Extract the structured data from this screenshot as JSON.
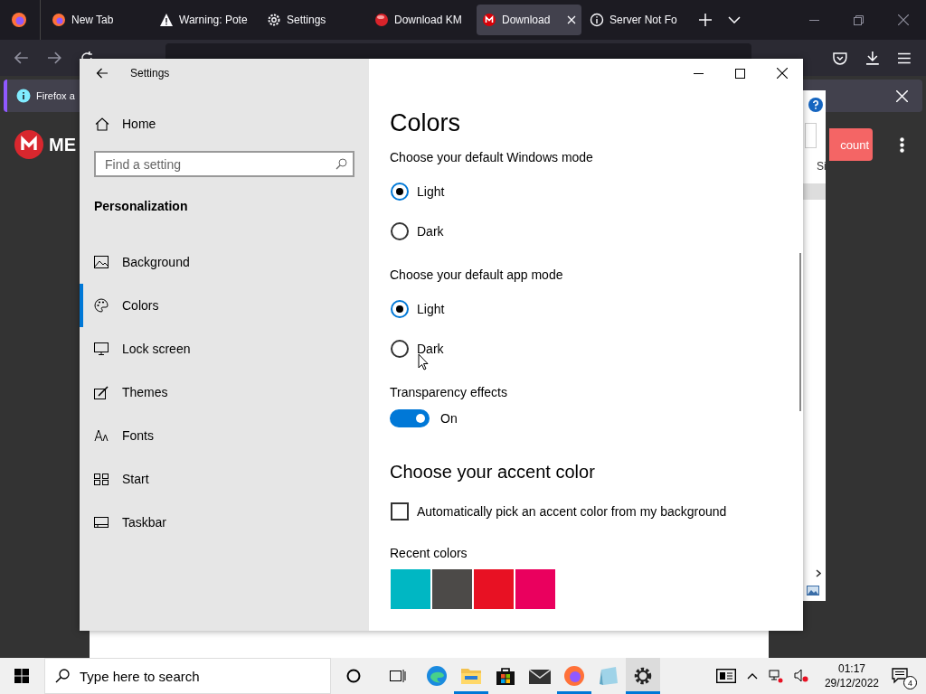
{
  "browser": {
    "tabs": [
      {
        "label": "New Tab",
        "kind": "firefox",
        "selected": false
      },
      {
        "label": "Warning: Pote",
        "kind": "warning",
        "selected": false
      },
      {
        "label": "Settings",
        "kind": "gear",
        "selected": false
      },
      {
        "label": "Download KM",
        "kind": "ball",
        "selected": false
      },
      {
        "label": "Download",
        "kind": "mega",
        "selected": true
      },
      {
        "label": "Server Not Fo",
        "kind": "info",
        "selected": false
      }
    ],
    "notification": {
      "text": "Firefox a"
    },
    "page": {
      "logo_text": "ME",
      "button": "count",
      "column_1": "Si"
    }
  },
  "settings": {
    "title": "Settings",
    "home": "Home",
    "search": {
      "placeholder": "Find a setting"
    },
    "section": "Personalization",
    "nav": [
      {
        "label": "Background",
        "kind": "background",
        "selected": false
      },
      {
        "label": "Colors",
        "kind": "colors",
        "selected": true
      },
      {
        "label": "Lock screen",
        "kind": "lock",
        "selected": false
      },
      {
        "label": "Themes",
        "kind": "themes",
        "selected": false
      },
      {
        "label": "Fonts",
        "kind": "fonts",
        "selected": false
      },
      {
        "label": "Start",
        "kind": "start",
        "selected": false
      },
      {
        "label": "Taskbar",
        "kind": "taskbar",
        "selected": false
      }
    ],
    "heading": "Colors",
    "groups": [
      {
        "label": "Choose your default Windows mode",
        "options": [
          {
            "label": "Light",
            "selected": true
          },
          {
            "label": "Dark",
            "selected": false
          }
        ]
      },
      {
        "label": "Choose your default app mode",
        "options": [
          {
            "label": "Light",
            "selected": true
          },
          {
            "label": "Dark",
            "selected": false
          }
        ]
      }
    ],
    "transparency": {
      "label": "Transparency effects",
      "on": true,
      "state": "On"
    },
    "accent_heading": "Choose your accent color",
    "auto_pick": {
      "label": "Automatically pick an accent color from my background",
      "checked": false
    },
    "recent": {
      "label": "Recent colors",
      "colors": [
        {
          "color": "#00b7c3"
        },
        {
          "color": "#4c4a48"
        },
        {
          "color": "#e81123"
        },
        {
          "color": "#ea005e"
        }
      ]
    }
  },
  "taskbar": {
    "search": {
      "placeholder": "Type here to search"
    },
    "apps": [
      {
        "kind": "edge",
        "running": false
      },
      {
        "kind": "explorer",
        "running": true
      },
      {
        "kind": "store",
        "running": false
      },
      {
        "kind": "mail",
        "running": false
      },
      {
        "kind": "firefox",
        "running": true
      },
      {
        "kind": "notepad",
        "running": false
      },
      {
        "kind": "settings",
        "running": true
      }
    ],
    "time": "01:17",
    "date": "29/12/2022",
    "notifications": "4"
  }
}
